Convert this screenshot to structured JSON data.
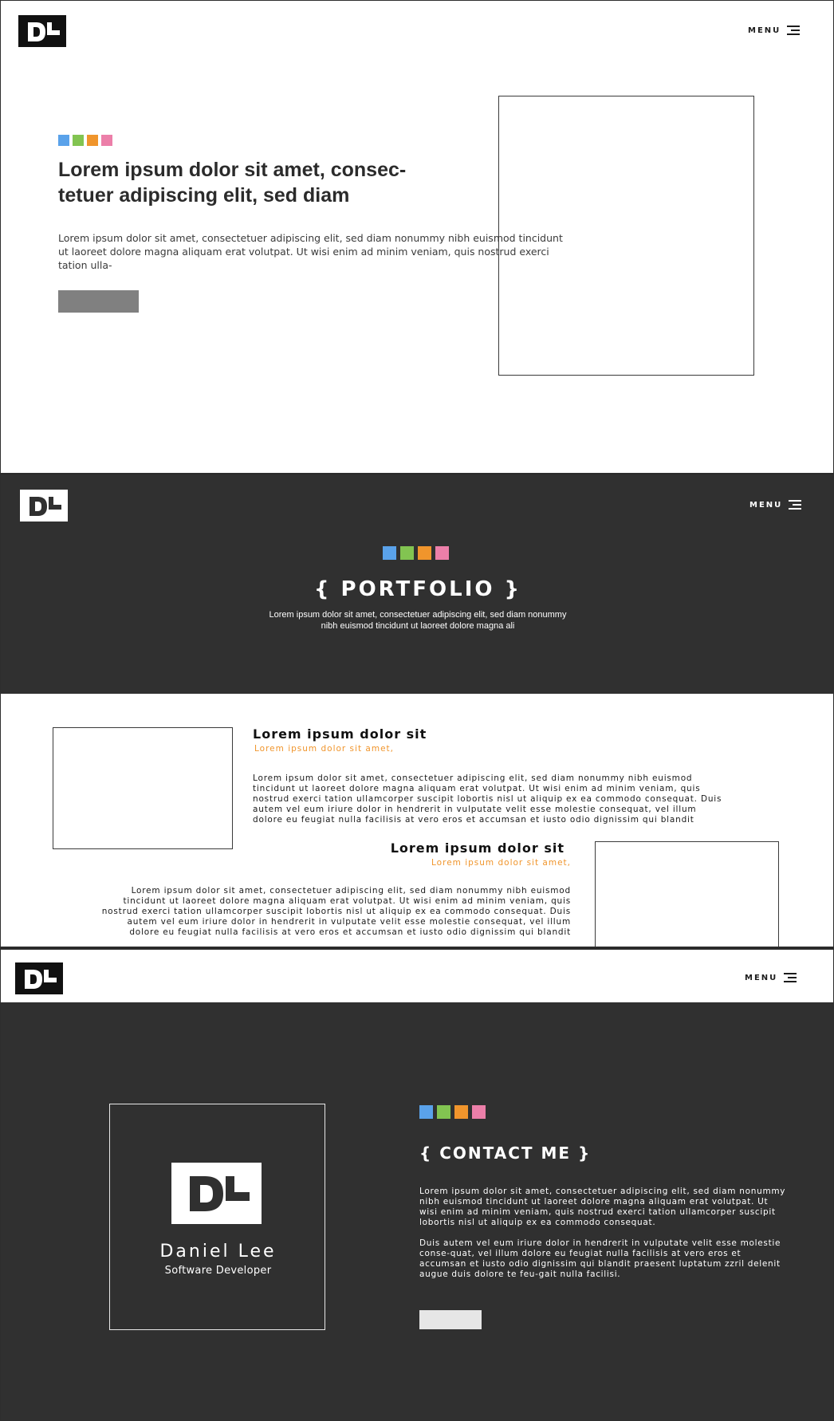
{
  "brand": {
    "logo_text": "DL"
  },
  "menu": {
    "label": "MENU"
  },
  "swatches": [
    "#5aa2ea",
    "#82c451",
    "#f0952c",
    "#ec7fa9"
  ],
  "hero": {
    "title": "Lorem ipsum dolor sit amet, consec-tetuer adipiscing elit, sed diam",
    "body": "Lorem ipsum dolor sit amet, consectetuer adipiscing elit, sed diam nonummy nibh euismod tincidunt ut laoreet dolore magna aliquam erat volutpat. Ut wisi enim ad minim veniam, quis nostrud exerci tation ulla-"
  },
  "portfolio": {
    "title": "{ PORTFOLIO }",
    "subtitle": "Lorem ipsum dolor sit amet, consectetuer adipiscing elit, sed diam nonummy nibh euismod tincidunt ut laoreet dolore magna ali",
    "items": [
      {
        "title": "Lorem ipsum dolor sit",
        "subtitle": "Lorem ipsum dolor sit amet,",
        "body": "Lorem ipsum dolor sit amet, consectetuer adipiscing elit, sed diam nonummy nibh euismod tincidunt ut laoreet dolore magna aliquam erat volutpat. Ut wisi enim ad minim veniam, quis nostrud exerci tation ullamcorper suscipit lobortis nisl ut aliquip ex ea commodo consequat. Duis autem vel eum iriure dolor in hendrerit in vulputate velit esse molestie consequat, vel illum dolore eu feugiat nulla facilisis at vero eros et accumsan et iusto odio dignissim qui blandit"
      },
      {
        "title": "Lorem ipsum dolor sit",
        "subtitle": "Lorem ipsum dolor sit amet,",
        "body": "Lorem ipsum dolor sit amet, consectetuer adipiscing elit, sed diam nonummy nibh euismod tincidunt ut laoreet dolore magna aliquam erat volutpat. Ut wisi enim ad minim veniam, quis nostrud exerci tation ullamcorper suscipit lobortis nisl ut aliquip ex ea commodo consequat. Duis autem vel eum iriure dolor in hendrerit in vulputate velit esse molestie consequat, vel illum dolore eu feugiat nulla facilisis at vero eros et accumsan et iusto odio dignissim qui blandit"
      }
    ]
  },
  "contact": {
    "name": "Daniel Lee",
    "role": "Software Developer",
    "title": "{ CONTACT ME }",
    "paragraph1": "Lorem ipsum dolor sit amet, consectetuer adipiscing elit, sed diam nonummy nibh euismod tincidunt ut laoreet dolore magna aliquam erat volutpat. Ut wisi enim ad minim veniam, quis nostrud exerci tation ullamcorper suscipit lobortis nisl ut aliquip ex ea commodo consequat.",
    "paragraph2": "Duis autem vel eum iriure dolor in hendrerit in vulputate velit esse molestie conse-quat, vel illum dolore eu feugiat nulla facilisis at vero eros et accumsan et iusto odio dignissim qui blandit praesent luptatum zzril delenit augue duis dolore te feu-gait nulla facilisi."
  }
}
